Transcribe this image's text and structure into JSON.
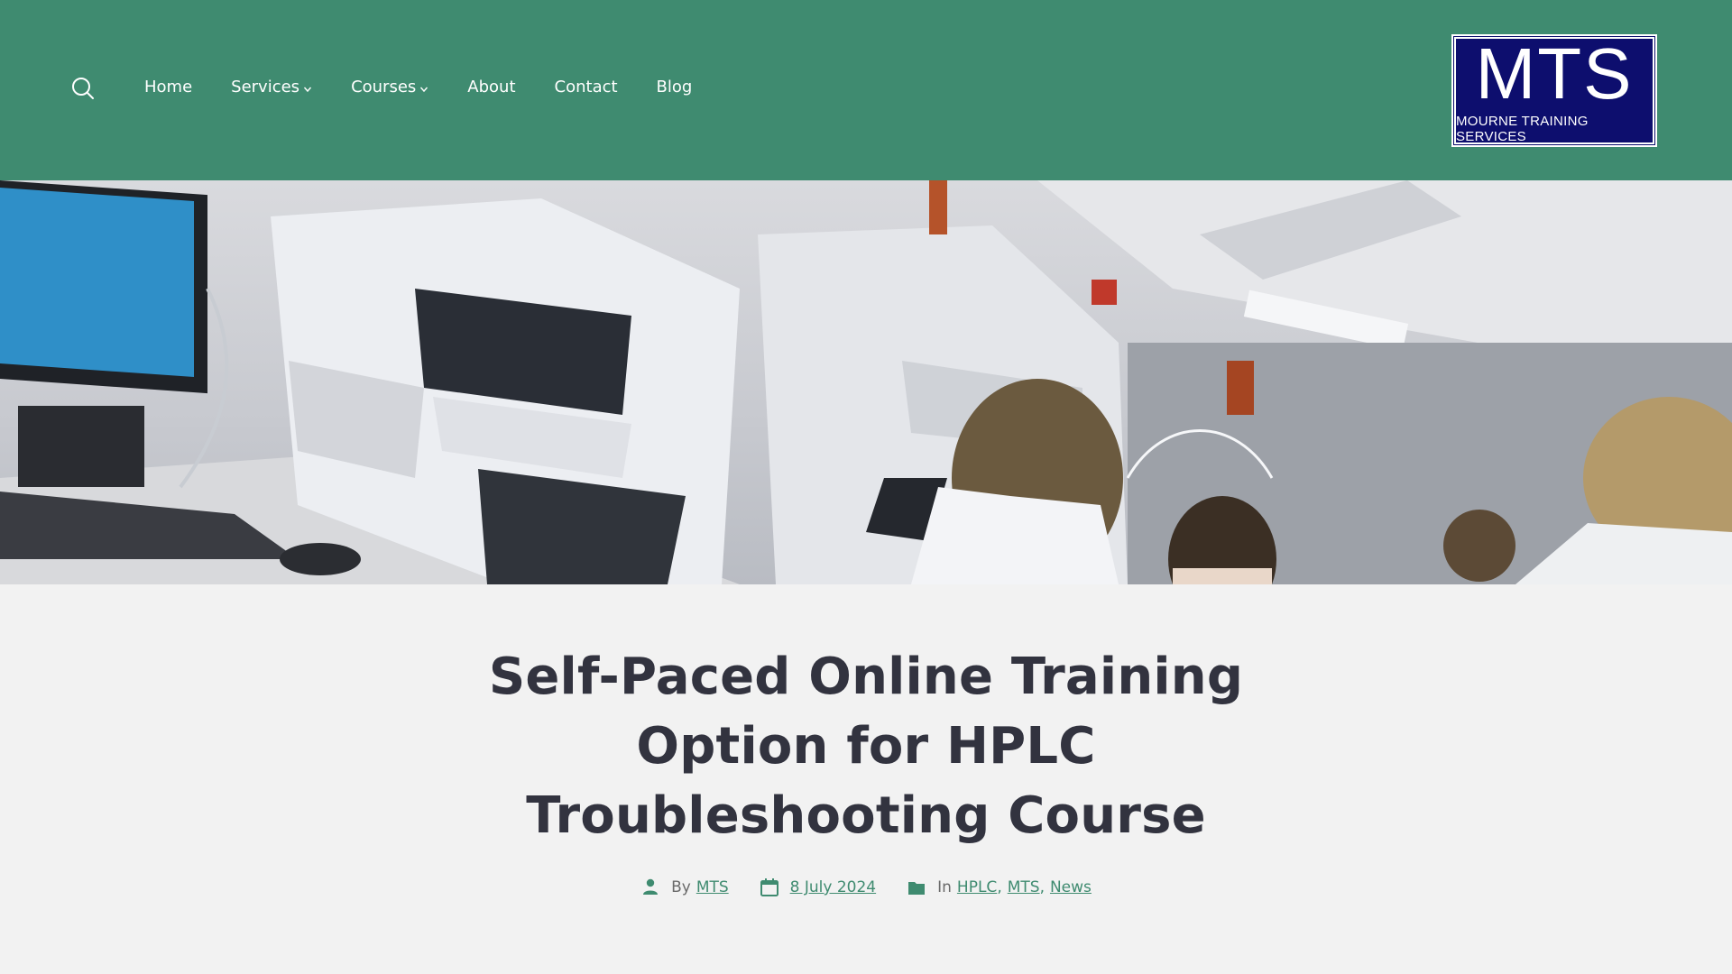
{
  "header": {
    "nav": [
      {
        "label": "Home",
        "has_submenu": false
      },
      {
        "label": "Services",
        "has_submenu": true
      },
      {
        "label": "Courses",
        "has_submenu": true
      },
      {
        "label": "About",
        "has_submenu": false
      },
      {
        "label": "Contact",
        "has_submenu": false
      },
      {
        "label": "Blog",
        "has_submenu": false
      }
    ],
    "logo": {
      "main": "MTS",
      "sub": "MOURNE TRAINING SERVICES"
    },
    "icons": {
      "search": "search-icon",
      "submenu": "chevron-down-icon"
    }
  },
  "hero": {
    "icon": "laboratory-photo"
  },
  "article": {
    "title": "Self-Paced Online Training Option for HPLC Troubleshooting Course",
    "meta": {
      "author_prefix": "By",
      "author": "MTS",
      "date": "8 July 2024",
      "category_prefix": "In",
      "categories": [
        "HPLC",
        "MTS",
        "News"
      ],
      "category_separator": ","
    }
  },
  "colors": {
    "header_bg": "#3f8b70",
    "page_bg": "#f2f2f2",
    "title": "#32333f",
    "accent": "#3f8b70",
    "logo_bg": "#0d0e6e"
  }
}
